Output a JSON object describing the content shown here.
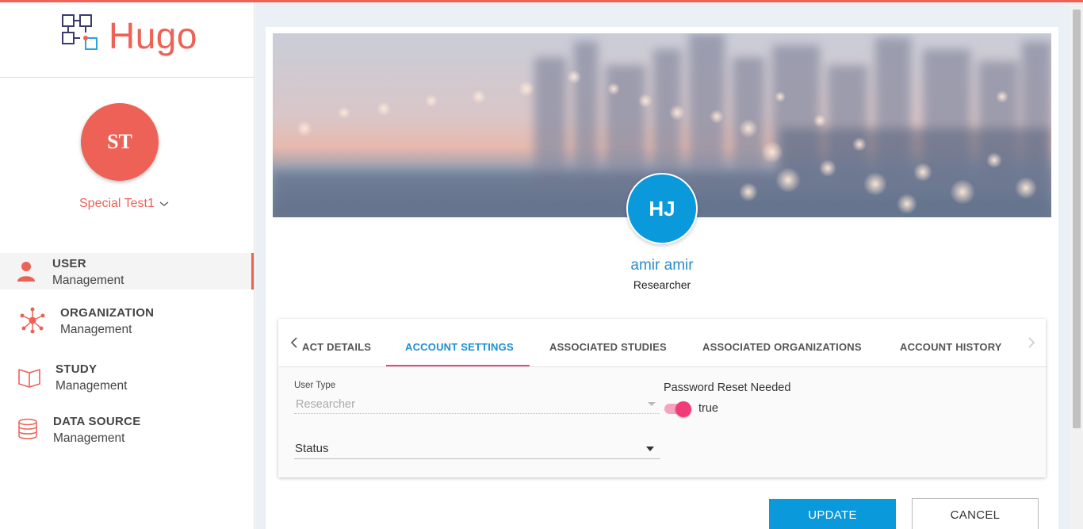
{
  "brand": {
    "name": "Hugo",
    "accent": "#ee6156"
  },
  "current_user": {
    "initials": "ST",
    "name": "Special Test1"
  },
  "nav": [
    {
      "title": "USER",
      "subtitle": "Management",
      "icon": "person-icon",
      "active": true
    },
    {
      "title": "ORGANIZATION",
      "subtitle": "Management",
      "icon": "network-icon",
      "active": false
    },
    {
      "title": "STUDY",
      "subtitle": "Management",
      "icon": "open-book-icon",
      "active": false
    },
    {
      "title": "DATA SOURCE",
      "subtitle": "Management",
      "icon": "database-icon",
      "active": false
    }
  ],
  "profile": {
    "initials": "HJ",
    "name": "amir amir",
    "role": "Researcher",
    "avatar_color": "#0a99db"
  },
  "tabs": [
    {
      "label": "ACT DETAILS",
      "active": false
    },
    {
      "label": "ACCOUNT SETTINGS",
      "active": true
    },
    {
      "label": "ASSOCIATED STUDIES",
      "active": false
    },
    {
      "label": "ASSOCIATED ORGANIZATIONS",
      "active": false
    },
    {
      "label": "ACCOUNT HISTORY",
      "active": false
    }
  ],
  "form": {
    "user_type_label": "User Type",
    "user_type_value": "Researcher",
    "status_value": "Status",
    "password_reset_label": "Password Reset Needed",
    "password_reset_value": "true"
  },
  "actions": {
    "update_label": "UPDATE",
    "cancel_label": "CANCEL"
  },
  "colors": {
    "primary_blue": "#0a99db",
    "toggle_pink": "#f03c78",
    "tab_active": "#1a8fd6"
  }
}
